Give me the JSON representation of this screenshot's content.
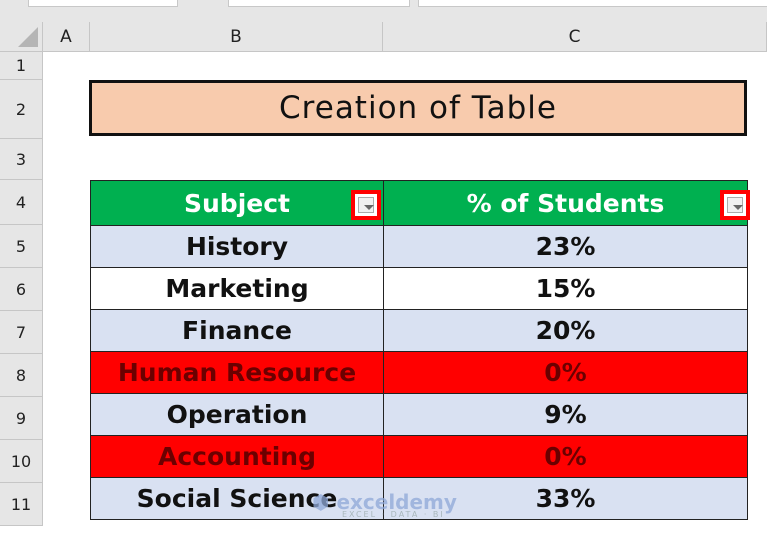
{
  "columns": [
    "A",
    "B",
    "C"
  ],
  "rows": [
    "1",
    "2",
    "3",
    "4",
    "5",
    "6",
    "7",
    "8",
    "9",
    "10",
    "11"
  ],
  "title": "Creation of Table",
  "table": {
    "headers": [
      "Subject",
      "% of Students"
    ],
    "rows": [
      {
        "subject": "History",
        "pct": "23%",
        "style": "blue"
      },
      {
        "subject": "Marketing",
        "pct": "15%",
        "style": "white"
      },
      {
        "subject": "Finance",
        "pct": "20%",
        "style": "blue"
      },
      {
        "subject": "Human Resource",
        "pct": "0%",
        "style": "red"
      },
      {
        "subject": "Operation",
        "pct": "9%",
        "style": "blue"
      },
      {
        "subject": "Accounting",
        "pct": "0%",
        "style": "red"
      },
      {
        "subject": "Social Science",
        "pct": "33%",
        "style": "blue"
      }
    ]
  },
  "colors": {
    "header": "#00b050",
    "title_fill": "#f8cbad",
    "band": "#d9e1f2",
    "highlight": "#ff0000"
  },
  "watermark": {
    "name": "exceldemy",
    "tagline": "EXCEL · DATA · BI"
  }
}
